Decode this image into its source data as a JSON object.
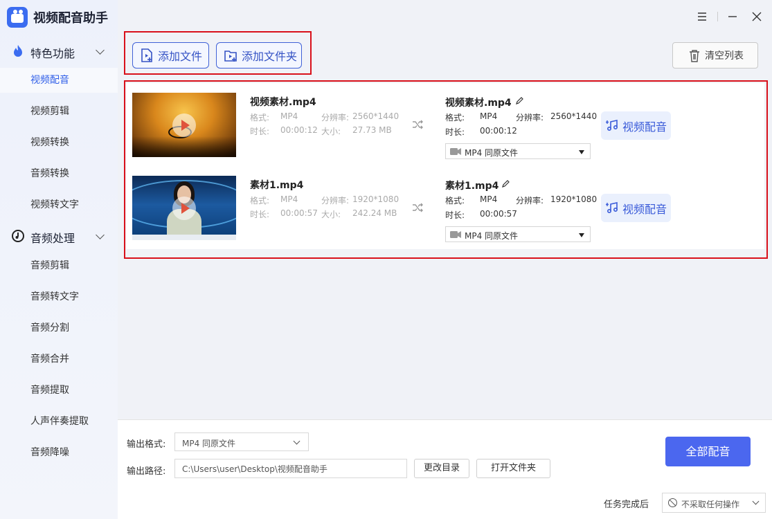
{
  "app": {
    "title": "视频配音助手"
  },
  "sidebar": {
    "groups": [
      {
        "label": "特色功能",
        "items": [
          "视频配音",
          "视频剪辑",
          "视频转换",
          "音频转换",
          "视频转文字"
        ]
      },
      {
        "label": "音频处理",
        "items": [
          "音频剪辑",
          "音频转文字",
          "音频分割",
          "音频合并",
          "音频提取",
          "人声伴奏提取",
          "音频降噪"
        ]
      }
    ],
    "active_item": "视频配音"
  },
  "toolbar": {
    "add_file_label": "添加文件",
    "add_folder_label": "添加文件夹",
    "clear_list_label": "清空列表"
  },
  "colors": {
    "accent": "#4b67ef",
    "highlight_box": "#d9101a"
  },
  "files": [
    {
      "name": "视频素材.mp4",
      "format_label": "格式:",
      "format": "MP4",
      "resolution_label": "分辨率:",
      "resolution": "2560*1440",
      "duration_label": "时长:",
      "duration": "00:00:12",
      "size_label": "大小:",
      "size": "27.73 MB",
      "output_name": "视频素材.mp4",
      "output_format": "MP4",
      "output_resolution": "2560*1440",
      "output_duration": "00:00:12",
      "output_select": "MP4  同原文件",
      "dub_label": "视频配音"
    },
    {
      "name": "素材1.mp4",
      "format_label": "格式:",
      "format": "MP4",
      "resolution_label": "分辨率:",
      "resolution": "1920*1080",
      "duration_label": "时长:",
      "duration": "00:00:57",
      "size_label": "大小:",
      "size": "242.24 MB",
      "output_name": "素材1.mp4",
      "output_format": "MP4",
      "output_resolution": "1920*1080",
      "output_duration": "00:00:57",
      "output_select": "MP4  同原文件",
      "dub_label": "视频配音"
    }
  ],
  "bottom": {
    "output_format_label": "输出格式:",
    "output_format_value": "MP4  同原文件",
    "output_path_label": "输出路径:",
    "output_path_value": "C:\\Users\\user\\Desktop\\视频配音助手",
    "change_dir_label": "更改目录",
    "open_folder_label": "打开文件夹",
    "dub_all_label": "全部配音",
    "after_task_label": "任务完成后",
    "after_task_value": "不采取任何操作"
  }
}
